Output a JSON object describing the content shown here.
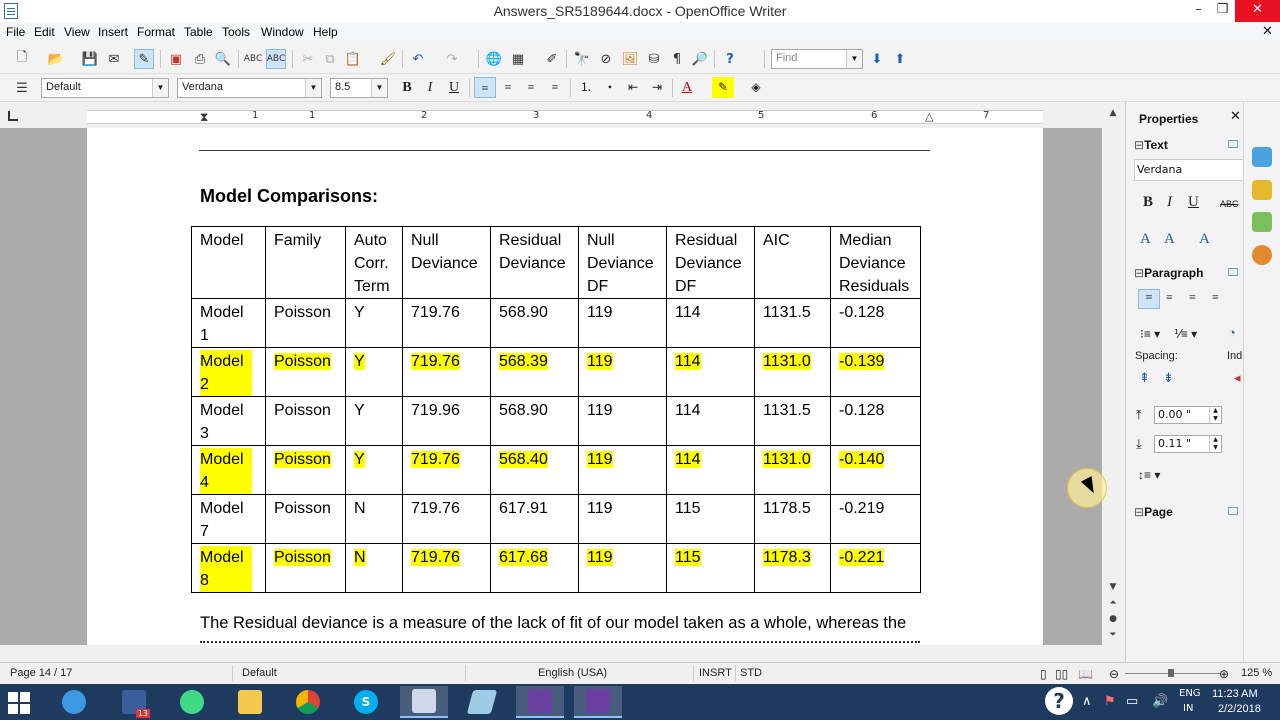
{
  "window": {
    "title": "Answers_SR5189644.docx - OpenOffice Writer",
    "minimize": "–",
    "maximize": "❐",
    "close": "✕"
  },
  "menu": [
    "File",
    "Edit",
    "View",
    "Insert",
    "Format",
    "Table",
    "Tools",
    "Window",
    "Help"
  ],
  "toolbar": {
    "find_placeholder": "Find",
    "paragraph_style": "Default",
    "font_name": "Verdana",
    "font_size": "8.5"
  },
  "ruler": {
    "numbers": [
      "1",
      "1",
      "2",
      "3",
      "4",
      "5",
      "6",
      "7"
    ]
  },
  "document": {
    "heading": "Model Comparisons:",
    "table": {
      "headers": [
        [
          "Model"
        ],
        [
          "Family"
        ],
        [
          "Auto",
          "Corr.",
          "Term"
        ],
        [
          "Null",
          "Deviance"
        ],
        [
          "Residual",
          "Deviance"
        ],
        [
          "Null",
          "Deviance",
          "DF"
        ],
        [
          "Residual",
          "Deviance",
          "DF"
        ],
        [
          "AIC"
        ],
        [
          "Median",
          "Deviance",
          "Residuals"
        ]
      ],
      "rows": [
        {
          "highlight": false,
          "cells": [
            "Model 1",
            "Poisson",
            "Y",
            "719.76",
            "568.90",
            "119",
            "114",
            "1131.5",
            "-0.128"
          ]
        },
        {
          "highlight": true,
          "cells": [
            "Model 2",
            "Poisson",
            "Y",
            "719.76",
            "568.39",
            "119",
            "114",
            "1131.0",
            "-0.139"
          ]
        },
        {
          "highlight": false,
          "cells": [
            "Model 3",
            "Poisson",
            "Y",
            "719.96",
            "568.90",
            "119",
            "114",
            "1131.5",
            "-0.128"
          ]
        },
        {
          "highlight": true,
          "cells": [
            "Model 4",
            "Poisson",
            "Y",
            "719.76",
            "568.40",
            "119",
            "114",
            "1131.0",
            "-0.140"
          ]
        },
        {
          "highlight": false,
          "cells": [
            "Model 7",
            "Poisson",
            "N",
            "719.76",
            "617.91",
            "119",
            "115",
            "1178.5",
            "-0.219"
          ]
        },
        {
          "highlight": true,
          "cells": [
            "Model 8",
            "Poisson",
            "N",
            "719.76",
            "617.68",
            "119",
            "115",
            "1178.3",
            "-0.221"
          ]
        }
      ]
    },
    "paragraph": "The Residual deviance is a measure of the lack of fit of our model taken as a whole, whereas the"
  },
  "sidebar": {
    "title": "Properties",
    "sections": {
      "text": "Text",
      "paragraph": "Paragraph",
      "page": "Page"
    },
    "font": "Verdana",
    "spacing_label": "Spacing:",
    "indent_label": "Ind",
    "spacing_above": "0.00 \"",
    "spacing_below": "0.11 \""
  },
  "status": {
    "page": "Page 14 / 17",
    "style": "Default",
    "language": "English (USA)",
    "insert_mode": "INSRT",
    "selection_mode": "STD",
    "zoom": "125 %"
  },
  "taskbar": {
    "lang_line1": "ENG",
    "lang_line2": "IN",
    "time": "11:23 AM",
    "date": "2/2/2018",
    "badge": "13"
  },
  "colors": {
    "highlight": "#ffff00",
    "taskbar": "#1f3a5f",
    "close_button": "#e81123"
  }
}
